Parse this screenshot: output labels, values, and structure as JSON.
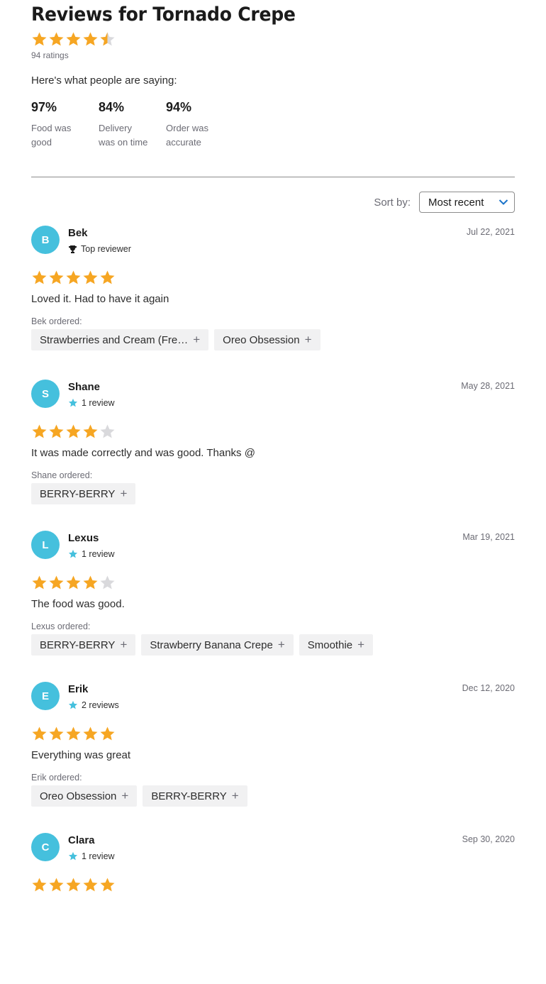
{
  "title": "Reviews for Tornado Crepe",
  "summary": {
    "rating": 4.5,
    "ratings_count": "94 ratings"
  },
  "saying_label": "Here's what people are saying:",
  "stats": [
    {
      "pct": "97%",
      "label": "Food was good"
    },
    {
      "pct": "84%",
      "label": "Delivery was on time"
    },
    {
      "pct": "94%",
      "label": "Order was accurate"
    }
  ],
  "sort": {
    "label": "Sort by:",
    "value": "Most recent"
  },
  "colors": {
    "star": "#f6a623",
    "star_empty": "#d9d9dc",
    "avatar": "#45c0dd",
    "reviewer_star": "#45c0dd"
  },
  "reviews": [
    {
      "initial": "B",
      "name": "Bek",
      "badge_icon": "trophy-icon",
      "badge": "Top reviewer",
      "date": "Jul 22, 2021",
      "rating": 5,
      "text": "Loved it. Had to have it again",
      "ordered_label": "Bek ordered:",
      "items": [
        "Strawberries and Cream (Fre…",
        "Oreo Obsession"
      ]
    },
    {
      "initial": "S",
      "name": "Shane",
      "badge_icon": "star-icon",
      "badge": "1 review",
      "date": "May 28, 2021",
      "rating": 4,
      "text": "It was made correctly and was good. Thanks @",
      "ordered_label": "Shane ordered:",
      "items": [
        "BERRY-BERRY"
      ]
    },
    {
      "initial": "L",
      "name": "Lexus",
      "badge_icon": "star-icon",
      "badge": "1 review",
      "date": "Mar 19, 2021",
      "rating": 4,
      "text": "The food was good.",
      "ordered_label": "Lexus ordered:",
      "items": [
        "BERRY-BERRY",
        "Strawberry Banana Crepe",
        "Smoothie"
      ]
    },
    {
      "initial": "E",
      "name": "Erik",
      "badge_icon": "star-icon",
      "badge": "2 reviews",
      "date": "Dec 12, 2020",
      "rating": 5,
      "text": "Everything was great",
      "ordered_label": "Erik ordered:",
      "items": [
        "Oreo Obsession",
        "BERRY-BERRY"
      ]
    },
    {
      "initial": "C",
      "name": "Clara",
      "badge_icon": "star-icon",
      "badge": "1 review",
      "date": "Sep 30, 2020",
      "rating": 5,
      "text": "",
      "ordered_label": "",
      "items": []
    }
  ]
}
